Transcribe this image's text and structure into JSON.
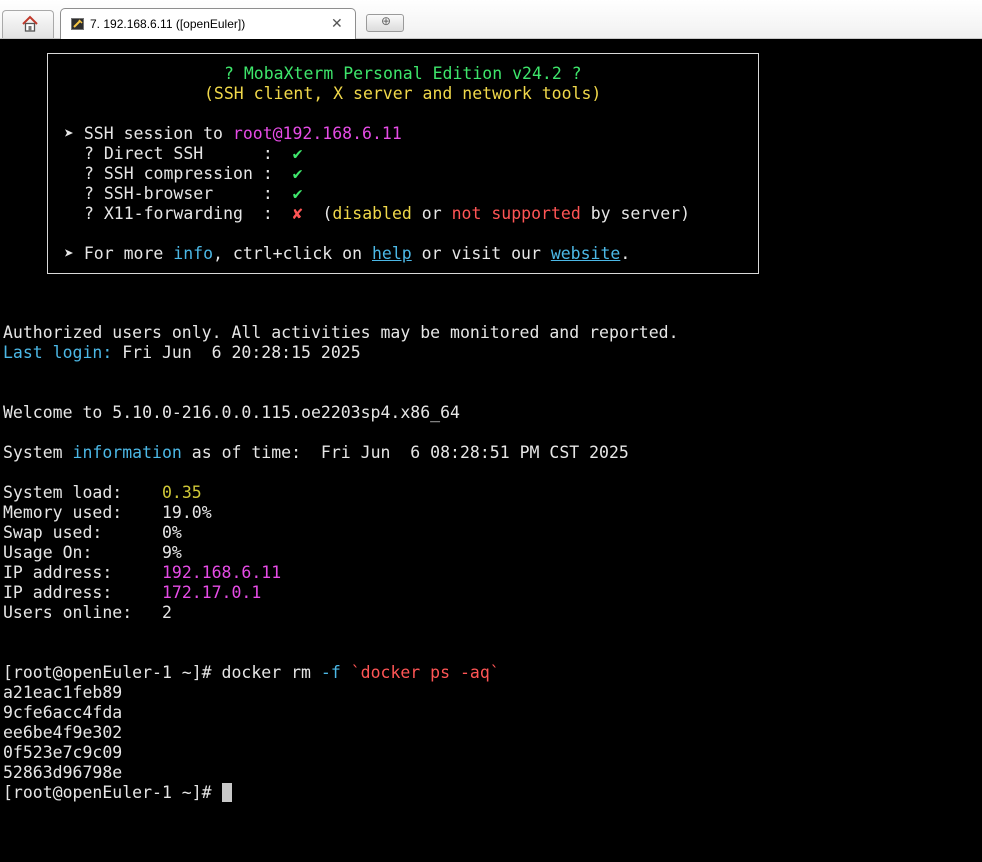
{
  "tabs": {
    "session_title": "7. 192.168.6.11 ([openEuler])",
    "close_glyph": "✕",
    "new_tab_glyph": "⊕"
  },
  "banner": {
    "title": "? MobaXterm Personal Edition v24.2 ?",
    "subtitle": "(SSH client, X server and network tools)",
    "arrow": "➤",
    "ssh_session_label": "SSH session to ",
    "ssh_target": "root@192.168.6.11",
    "checks": [
      {
        "prefix": "? ",
        "label": "Direct SSH      :",
        "mark": "✔"
      },
      {
        "prefix": "? ",
        "label": "SSH compression :",
        "mark": "✔"
      },
      {
        "prefix": "? ",
        "label": "SSH-browser     :",
        "mark": "✔"
      }
    ],
    "x11": {
      "prefix": "? ",
      "label": "X11-forwarding  :",
      "mark": "✘",
      "open": "(",
      "disabled": "disabled",
      "or": " or ",
      "not_supported": "not supported",
      "by_server": " by server)"
    },
    "more": {
      "t1": "For more ",
      "info": "info",
      "t2": ", ctrl+click on ",
      "help": "help",
      "t3": " or visit our ",
      "website": "website",
      "t4": "."
    }
  },
  "motd": {
    "authorized": "Authorized users only. All activities may be monitored and reported.",
    "last_login_label": "Last login:",
    "last_login_value": " Fri Jun  6 20:28:15 2025",
    "welcome": "Welcome to 5.10.0-216.0.0.115.oe2203sp4.x86_64",
    "sysinfo_pre": "System ",
    "sysinfo_word": "information",
    "sysinfo_post": " as of time:  Fri Jun  6 08:28:51 PM CST 2025"
  },
  "stats": [
    {
      "label": "System load:    ",
      "value": "0.35",
      "color": "olive"
    },
    {
      "label": "Memory used:    ",
      "value": "19.0%",
      "color": "default"
    },
    {
      "label": "Swap used:      ",
      "value": "0%",
      "color": "default"
    },
    {
      "label": "Usage On:       ",
      "value": "9%",
      "color": "default"
    },
    {
      "label": "IP address:     ",
      "value": "192.168.6.11",
      "color": "magenta"
    },
    {
      "label": "IP address:     ",
      "value": "172.17.0.1",
      "color": "magenta"
    },
    {
      "label": "Users online:   ",
      "value": "2",
      "color": "default"
    }
  ],
  "command": {
    "prompt": "[root@openEuler-1 ~]# ",
    "cmd": "docker rm ",
    "flag": "-f",
    "sp": " ",
    "sub": "`docker ps -aq`"
  },
  "output_ids": [
    "a21eac1feb89",
    "9cfe6acc4fda",
    "ee6be4f9e302",
    "0f523e7c9c09",
    "52863d96798e"
  ],
  "final_prompt": "[root@openEuler-1 ~]# "
}
